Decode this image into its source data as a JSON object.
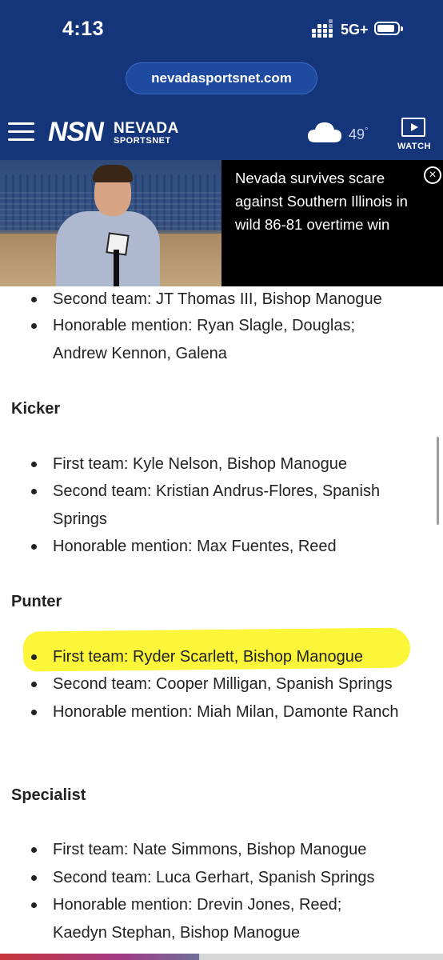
{
  "status_bar": {
    "time": "4:13",
    "network": "5G+"
  },
  "browser": {
    "url": "nevadasportsnet.com"
  },
  "site_header": {
    "logo_abbr": "NSN",
    "logo_line1": "NEVADA",
    "logo_line2": "SPORTSNET",
    "temperature": "49",
    "temperature_unit": "°",
    "watch_label": "WATCH",
    "weather_icon": "cloud-icon",
    "menu_icon": "hamburger-icon"
  },
  "video_banner": {
    "title": "Nevada survives scare against Southern Illinois in wild 86-81 overtime win",
    "close_icon": "close-icon"
  },
  "article": {
    "sections": [
      {
        "heading": "",
        "items": [
          "Second team: JT Thomas III, Bishop Manogue",
          "Honorable mention: Ryan Slagle, Douglas; Andrew Kennon, Galena"
        ]
      },
      {
        "heading": "Kicker",
        "items": [
          "First team: Kyle Nelson, Bishop Manogue",
          "Second team: Kristian Andrus-Flores, Spanish Springs",
          "Honorable mention: Max Fuentes, Reed"
        ]
      },
      {
        "heading": "Punter",
        "items": [
          "First team: Ryder Scarlett, Bishop Manogue",
          "Second team: Cooper Milligan, Spanish Springs",
          "Honorable mention: Miah Milan, Damonte Ranch"
        ]
      },
      {
        "heading": "Specialist",
        "items": [
          "First team: Nate Simmons, Bishop Manogue",
          "Second team: Luca Gerhart, Spanish Springs",
          "Honorable mention: Drevin Jones, Reed; Kaedyn Stephan, Bishop Manogue"
        ]
      }
    ]
  },
  "colors": {
    "header_bg": "#14357a",
    "highlight": "#fbf63a"
  },
  "reading_progress": 0.45
}
